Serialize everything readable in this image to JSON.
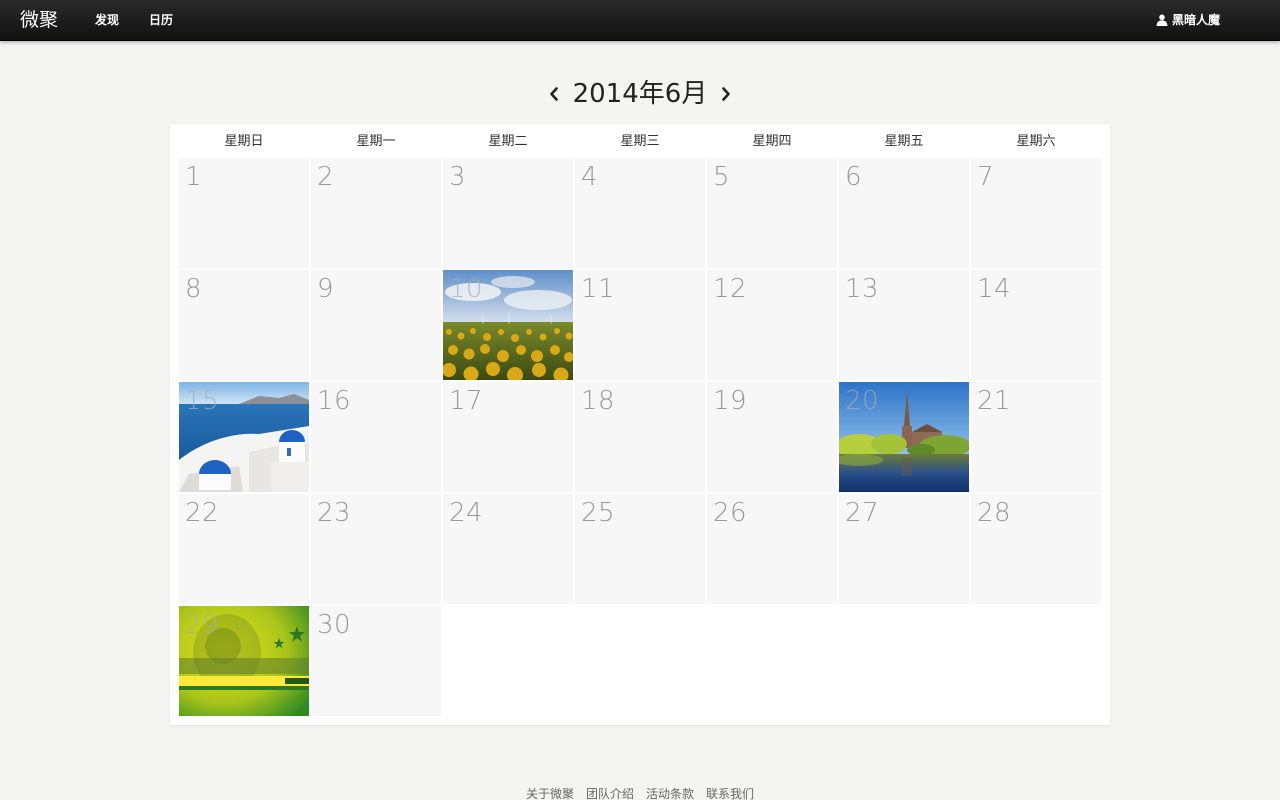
{
  "navbar": {
    "brand": "微聚",
    "links": [
      "发现",
      "日历"
    ],
    "user_name": "黑暗人魔",
    "user_icon": "user-icon"
  },
  "calendar": {
    "title": "2014年6月",
    "prev_icon": "chevron-left-icon",
    "next_icon": "chevron-right-icon",
    "weekdays": [
      "星期日",
      "星期一",
      "星期二",
      "星期三",
      "星期四",
      "星期五",
      "星期六"
    ],
    "days": [
      "1",
      "2",
      "3",
      "4",
      "5",
      "6",
      "7",
      "8",
      "9",
      "10",
      "11",
      "12",
      "13",
      "14",
      "15",
      "16",
      "17",
      "18",
      "19",
      "20",
      "21",
      "22",
      "23",
      "24",
      "25",
      "26",
      "27",
      "28",
      "29",
      "30"
    ],
    "photo_days": {
      "10": "sunflower-field-photo",
      "15": "santorini-coast-photo",
      "20": "church-lake-photo",
      "29": "brasil-football-photo"
    }
  },
  "footer": {
    "links": [
      "关于微聚",
      "团队介绍",
      "活动条款",
      "联系我们"
    ]
  }
}
